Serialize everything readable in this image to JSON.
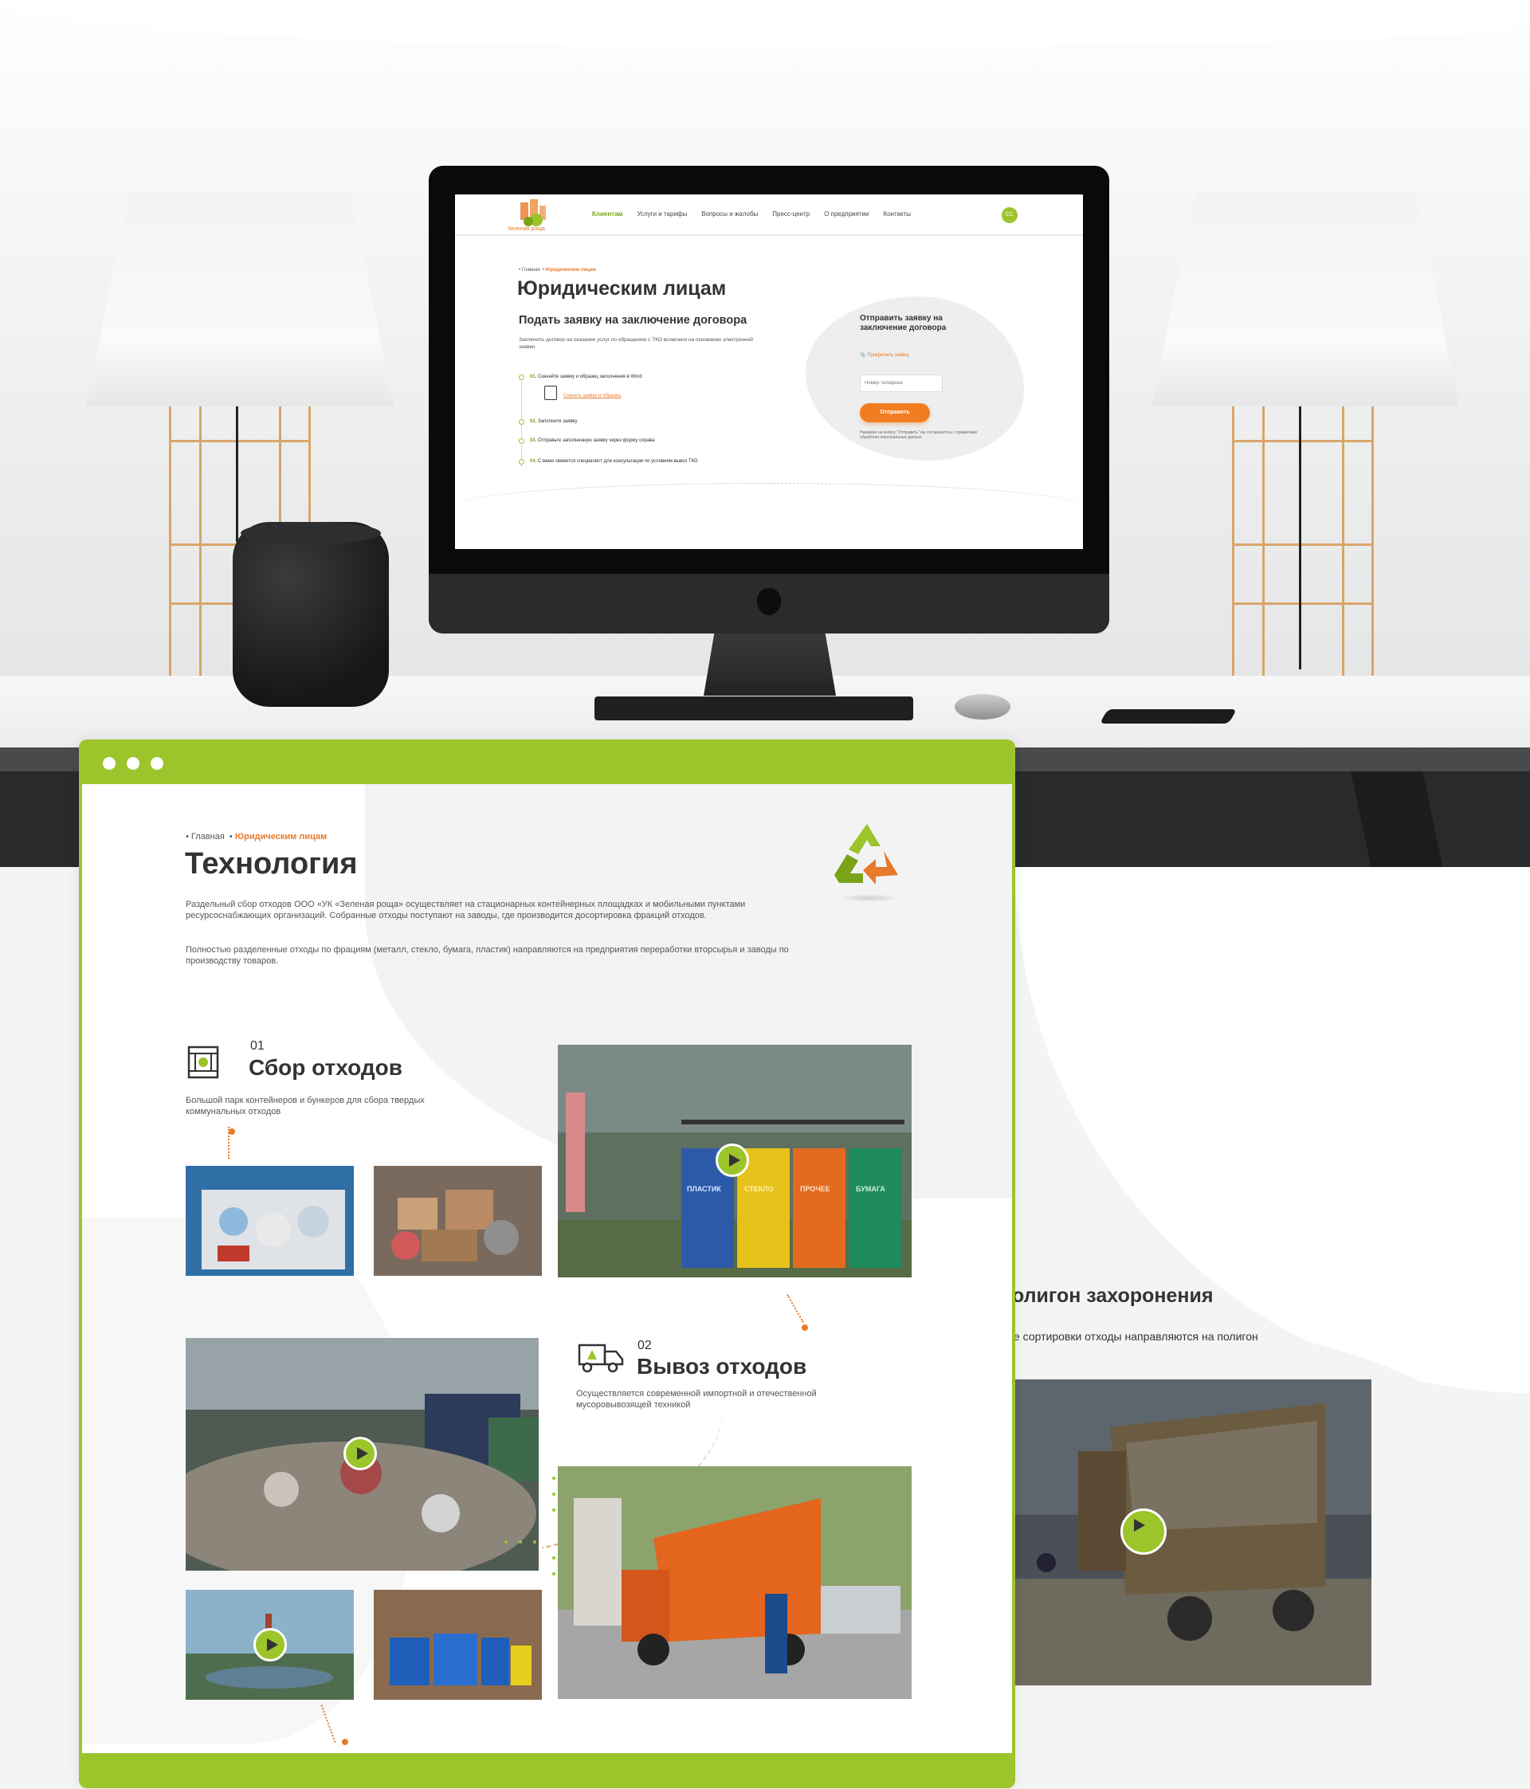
{
  "imac_site": {
    "logo_text": "Зеленая роща",
    "nav": [
      "Клиентам",
      "Услуги и тарифы",
      "Вопросы и жалобы",
      "Пресс-центр",
      "О предприятии",
      "Контакты"
    ],
    "lang": "СС",
    "breadcrumb_home": "Главная",
    "breadcrumb_current": "Юридическим лицам",
    "title": "Юридическим лицам",
    "subtitle": "Подать заявку на заключение договора",
    "intro": "Заключить договор на оказание услуг по обращению с ТКО возможно на основании электронной заявки",
    "steps": [
      {
        "num": "01.",
        "text": "Скачайте заявку и образец заполнения в Word"
      },
      {
        "num": "02.",
        "text": "Заполните заявку"
      },
      {
        "num": "03.",
        "text": "Отправьте заполненную заявку через форму справа"
      },
      {
        "num": "04.",
        "text": "С вами свяжется специалист для консультации по условиям вывоз ТКО"
      }
    ],
    "download_link": "Скачать заявку и образец",
    "form": {
      "title": "Отправить заявку на заключение договора",
      "attach_label": "Прикрепить заявку",
      "phone_placeholder": "Номер телефона",
      "submit": "Отправить",
      "consent": "Нажимая на кнопку \"Отправить\" вы соглашаетесь с правилами обработки персональных данных"
    }
  },
  "browser_page": {
    "breadcrumb_home": "Главная",
    "breadcrumb_current": "Юридическим лицам",
    "title": "Технология",
    "paragraph1": "Раздельный сбор отходов ООО «УК «Зеленая роща» осуществляет на стационарных контейнерных площадках и мобильными пунктами ресурсоснабжающих организаций. Собранные отходы поступают на заводы, где производится досортировка фракций отходов.",
    "paragraph2": "Полностью разделенные отходы по фрациям (металл, стекло, бумага, пластик) направляются на предприятия переработки вторсырья и заводы по производству товаров.",
    "sections": [
      {
        "num": "01",
        "title": "Сбор отходов",
        "desc": "Большой парк контейнеров и бункеров для сбора твердых коммунальных отходов"
      },
      {
        "num": "02",
        "title": "Вывоз отходов",
        "desc": "Осуществляется современной импортной и отечественной мусоровывозящей техникой"
      }
    ],
    "bin_labels": [
      "ПЛАСТИК",
      "СТЕКЛО",
      "ПРОЧЕЕ",
      "БУМАГА"
    ]
  },
  "right_section": {
    "title": "олигон захоронения",
    "desc": "е сортировки отходы направляются на полигон"
  },
  "colors": {
    "accent_green": "#9cc42b",
    "accent_orange": "#e87a2b",
    "text_dark": "#333333"
  }
}
